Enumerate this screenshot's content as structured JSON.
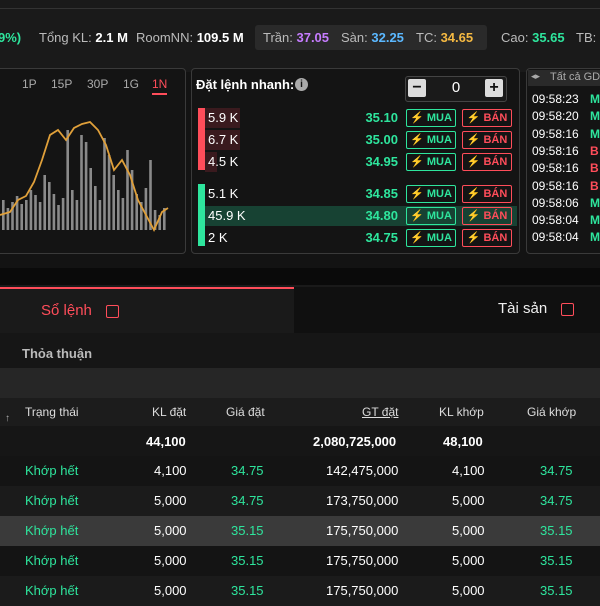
{
  "header": {
    "change_pct": "9%)",
    "total_vol_label": "Tổng KL:",
    "total_vol": "2.1 M",
    "room_label": "RoomNN:",
    "room": "109.5 M",
    "ceiling_label": "Trần:",
    "ceiling": "37.05",
    "floor_label": "Sàn:",
    "floor": "32.25",
    "ref_label": "TC:",
    "ref": "34.65",
    "high_label": "Cao:",
    "high": "35.65",
    "avg_label": "TB:"
  },
  "chart": {
    "timeframes": [
      "1P",
      "15P",
      "30P",
      "1G",
      "1N"
    ],
    "active_timeframe": "1N",
    "line_color": "#e0a03a",
    "bar_color": "#8a8a8a"
  },
  "order_book": {
    "title": "Đặt lệnh nhanh:",
    "quantity": "0",
    "minus": "−",
    "plus": "+",
    "buy_label": "MUA",
    "sell_label": "BÁN",
    "asks": [
      {
        "vol": "5.9 K",
        "price": "35.10"
      },
      {
        "vol": "6.7 K",
        "price": "35.00"
      },
      {
        "vol": "4.5 K",
        "price": "34.95"
      }
    ],
    "bids": [
      {
        "vol": "5.1 K",
        "price": "34.85"
      },
      {
        "vol": "45.9 K",
        "price": "34.80"
      },
      {
        "vol": "2 K",
        "price": "34.75"
      }
    ]
  },
  "tape": {
    "header": "Tất cả GD",
    "rows": [
      {
        "time": "09:58:23",
        "side": "M"
      },
      {
        "time": "09:58:20",
        "side": "M"
      },
      {
        "time": "09:58:16",
        "side": "M"
      },
      {
        "time": "09:58:16",
        "side": "B"
      },
      {
        "time": "09:58:16",
        "side": "B"
      },
      {
        "time": "09:58:16",
        "side": "B"
      },
      {
        "time": "09:58:06",
        "side": "M"
      },
      {
        "time": "09:58:04",
        "side": "M"
      },
      {
        "time": "09:58:04",
        "side": "M"
      }
    ]
  },
  "tabs": {
    "orders": "Sổ lệnh",
    "assets": "Tài sản"
  },
  "subtab": "Thỏa thuận",
  "table": {
    "columns": [
      "Trạng thái",
      "KL đặt",
      "Giá đặt",
      "GT đặt",
      "KL khớp",
      "Giá khớp"
    ],
    "totals": {
      "kl_dat": "44,100",
      "gt_dat": "2,080,725,000",
      "kl_khop": "48,100"
    },
    "rows": [
      {
        "status": "Khớp hết",
        "kl_dat": "4,100",
        "gia_dat": "34.75",
        "gt_dat": "142,475,000",
        "kl_khop": "4,100",
        "gia_khop": "34.75"
      },
      {
        "status": "Khớp hết",
        "kl_dat": "5,000",
        "gia_dat": "34.75",
        "gt_dat": "173,750,000",
        "kl_khop": "5,000",
        "gia_khop": "34.75"
      },
      {
        "status": "Khớp hết",
        "kl_dat": "5,000",
        "gia_dat": "35.15",
        "gt_dat": "175,750,000",
        "kl_khop": "5,000",
        "gia_khop": "35.15"
      },
      {
        "status": "Khớp hết",
        "kl_dat": "5,000",
        "gia_dat": "35.15",
        "gt_dat": "175,750,000",
        "kl_khop": "5,000",
        "gia_khop": "35.15"
      },
      {
        "status": "Khớp hết",
        "kl_dat": "5,000",
        "gia_dat": "35.15",
        "gt_dat": "175,750,000",
        "kl_khop": "5,000",
        "gia_khop": "35.15"
      }
    ]
  },
  "colors": {
    "up": "#2ee59d",
    "down": "#ff4d5a",
    "ceiling": "#c67cff",
    "floor": "#5bb8ff",
    "ref": "#f5b942"
  }
}
